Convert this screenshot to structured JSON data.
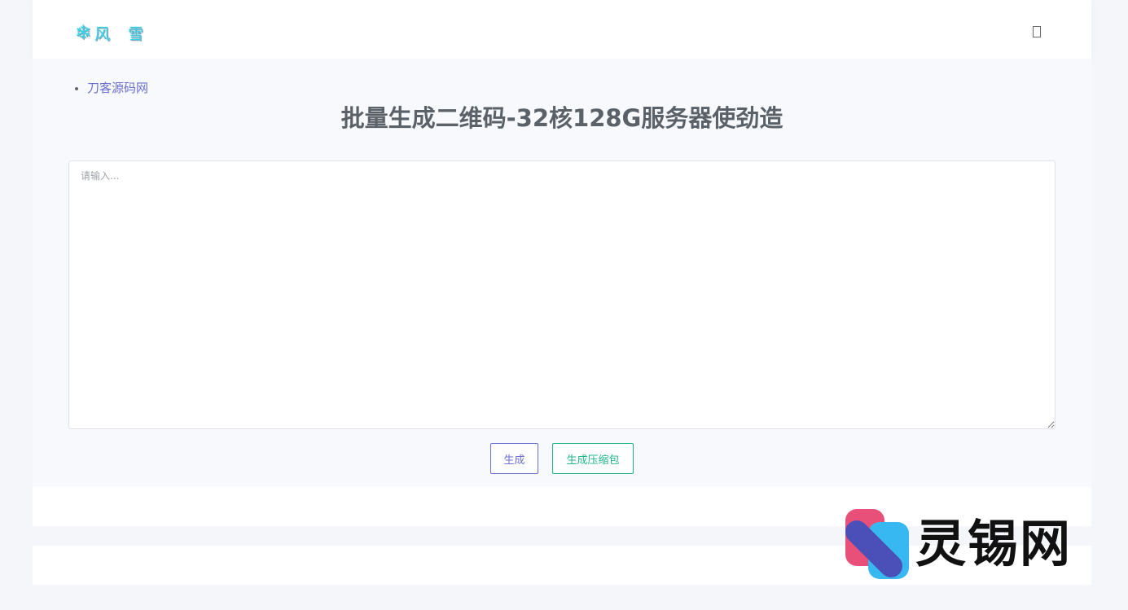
{
  "header": {
    "logo_text": "风 雪",
    "logo_icon": "snowflake-icon",
    "menu_icon": "menu-icon"
  },
  "nav": {
    "links": [
      {
        "label": "刀客源码网"
      }
    ]
  },
  "main": {
    "title": "批量生成二维码-32核128G服务器使劲造",
    "input": {
      "placeholder": "请输入...",
      "value": ""
    },
    "buttons": {
      "generate_label": "生成",
      "zip_label": "生成压缩包"
    }
  },
  "watermark": {
    "text": "灵锡网"
  },
  "colors": {
    "primary": "#6a6fd1",
    "success": "#23b58a",
    "logo": "#38d3e8",
    "title": "#5a6168",
    "watermark_pink": "#e8507a",
    "watermark_blue": "#38b8f0",
    "watermark_indigo": "#4a50b8"
  }
}
